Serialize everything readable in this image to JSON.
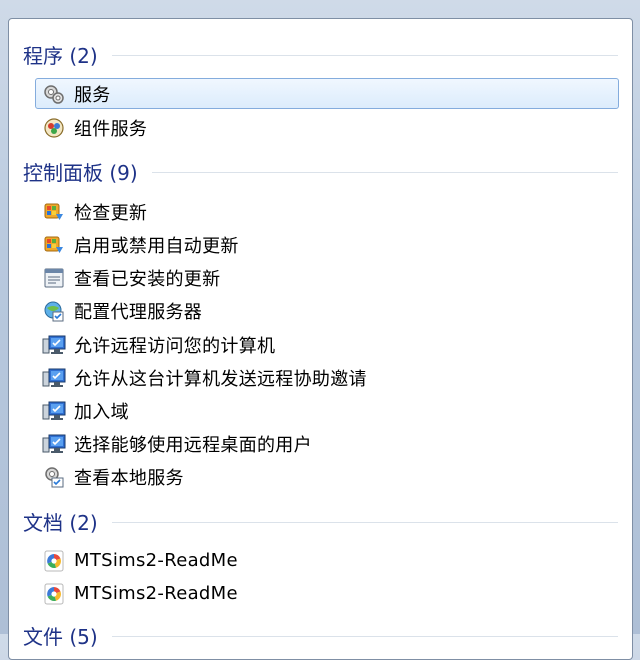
{
  "sections": [
    {
      "title": "程序 (2)",
      "items": [
        {
          "label": "服务",
          "icon": "services-gear-icon",
          "selected": true
        },
        {
          "label": "组件服务",
          "icon": "component-services-icon"
        }
      ]
    },
    {
      "title": "控制面板 (9)",
      "items": [
        {
          "label": "检查更新",
          "icon": "windows-update-icon"
        },
        {
          "label": "启用或禁用自动更新",
          "icon": "windows-update-icon"
        },
        {
          "label": "查看已安装的更新",
          "icon": "installed-updates-icon"
        },
        {
          "label": "配置代理服务器",
          "icon": "internet-options-icon"
        },
        {
          "label": "允许远程访问您的计算机",
          "icon": "remote-computer-icon"
        },
        {
          "label": "允许从这台计算机发送远程协助邀请",
          "icon": "remote-computer-icon"
        },
        {
          "label": "加入域",
          "icon": "remote-computer-icon"
        },
        {
          "label": "选择能够使用远程桌面的用户",
          "icon": "remote-computer-icon"
        },
        {
          "label": "查看本地服务",
          "icon": "local-services-icon"
        }
      ]
    },
    {
      "title": "文档 (2)",
      "items": [
        {
          "label": "MTSims2-ReadMe",
          "icon": "document-app-icon"
        },
        {
          "label": "MTSims2-ReadMe",
          "icon": "document-app-icon"
        }
      ]
    },
    {
      "title": "文件 (5)",
      "items": []
    }
  ]
}
